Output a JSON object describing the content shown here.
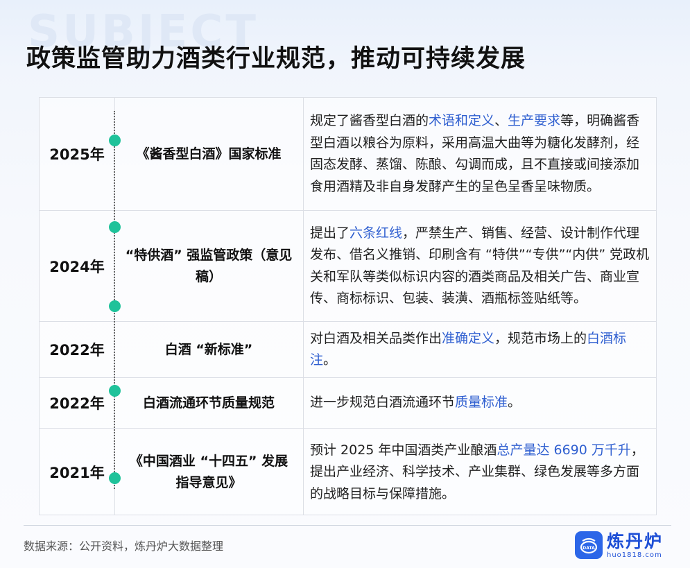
{
  "background_word": "SUBJECT",
  "title": "政策监管助力酒类行业规范，推动可持续发展",
  "rows": [
    {
      "year": "2025年",
      "name": "《酱香型白酒》国家标准",
      "desc": [
        {
          "t": "规定了酱香型白酒的",
          "h": false
        },
        {
          "t": "术语和定义",
          "h": true
        },
        {
          "t": "、",
          "h": false
        },
        {
          "t": "生产要求",
          "h": true
        },
        {
          "t": "等，明确酱香型白酒以粮谷为原料，采用高温大曲等为糖化发酵剂，经固态发酵、蒸馏、陈酿、勾调而成，且不直接或间接添加食用酒精及非自身发酵产生的呈色呈香呈味物质。",
          "h": false
        }
      ]
    },
    {
      "year": "2024年",
      "name": "“特供酒” 强监管政策（意见稿）",
      "desc": [
        {
          "t": "提出了",
          "h": false
        },
        {
          "t": "六条红线",
          "h": true
        },
        {
          "t": "，严禁生产、销售、经营、设计制作代理发布、借名义推销、印刷含有 “特供”“专供”“内供” 党政机关和军队等类似标识内容的酒类商品及相关广告、商业宣传、商标标识、包装、装潢、酒瓶标签贴纸等。",
          "h": false
        }
      ]
    },
    {
      "year": "2022年",
      "name": "白酒 “新标准”",
      "desc": [
        {
          "t": "对白酒及相关品类作出",
          "h": false
        },
        {
          "t": "准确定义",
          "h": true
        },
        {
          "t": "，规范市场上的",
          "h": false
        },
        {
          "t": "白酒标注",
          "h": true
        },
        {
          "t": "。",
          "h": false
        }
      ]
    },
    {
      "year": "2022年",
      "name": "白酒流通环节质量规范",
      "desc": [
        {
          "t": "进一步规范白酒流通环节",
          "h": false
        },
        {
          "t": "质量标准",
          "h": true
        },
        {
          "t": "。",
          "h": false
        }
      ]
    },
    {
      "year": "2021年",
      "name": "《中国酒业 “十四五” 发展指导意见》",
      "desc": [
        {
          "t": "预计 2025 年中国酒类产业酿酒",
          "h": false
        },
        {
          "t": "总产量达 6690 万千升",
          "h": true
        },
        {
          "t": "，提出产业经济、科学技术、产业集群、绿色发展等多方面的战略目标与保障措施。",
          "h": false
        }
      ]
    }
  ],
  "source": "数据来源：公开资料，炼丹炉大数据整理",
  "logo": {
    "cn": "炼丹炉",
    "en": "huo1818.com",
    "badge": "DATA"
  },
  "colors": {
    "accent": "#1fc29a",
    "highlight": "#2f5fd0",
    "brand": "#2c66e8"
  }
}
